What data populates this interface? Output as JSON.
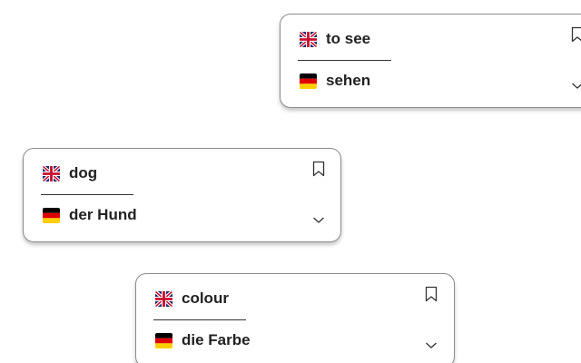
{
  "colors": {
    "text": "#222222",
    "card_border": "#8c8c8c",
    "uk_blue": "#1f2a6b",
    "uk_red": "#c8102e",
    "de_black": "#000000",
    "de_red": "#dd0000",
    "de_gold": "#ffce00"
  },
  "icons": {
    "source_flag": "uk-flag-icon",
    "target_flag": "germany-flag-icon",
    "bookmark": "bookmark-icon",
    "expand": "chevron-down-icon"
  },
  "cards": [
    {
      "source_word": "to see",
      "target_word": "sehen"
    },
    {
      "source_word": "dog",
      "target_word": "der Hund"
    },
    {
      "source_word": "colour",
      "target_word": "die Farbe"
    }
  ]
}
